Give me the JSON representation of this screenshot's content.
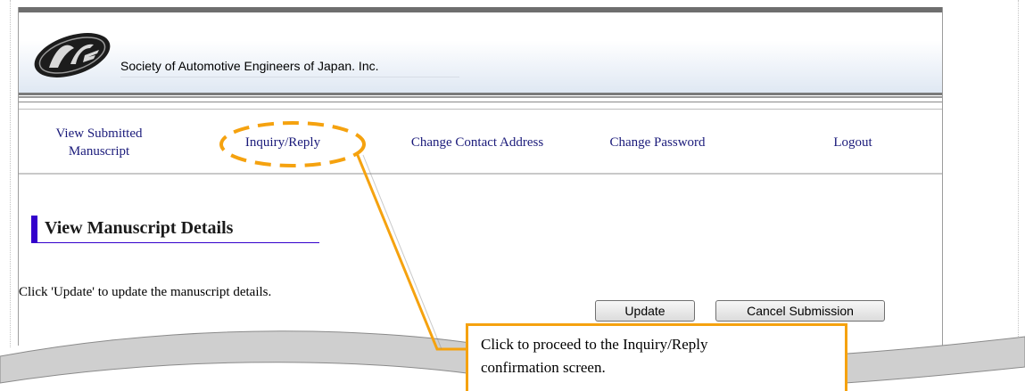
{
  "header": {
    "site_name": "Society of Automotive Engineers of Japan. Inc."
  },
  "nav": {
    "view_submitted_line1": "View Submitted",
    "view_submitted_line2": "Manuscript",
    "inquiry_reply": "Inquiry/Reply",
    "change_contact": "Change Contact Address",
    "change_password": "Change Password",
    "logout": "Logout"
  },
  "main": {
    "section_title": "View Manuscript Details",
    "instruction": "Click 'Update' to update the manuscript details.",
    "update_button": "Update",
    "cancel_button": "Cancel Submission"
  },
  "annotation": {
    "line1": "Click to proceed to the Inquiry/Reply",
    "line2": "confirmation screen.",
    "color": "#f5a20f"
  },
  "colors": {
    "heading_accent": "#3300cc",
    "link": "#1a1a7a"
  }
}
